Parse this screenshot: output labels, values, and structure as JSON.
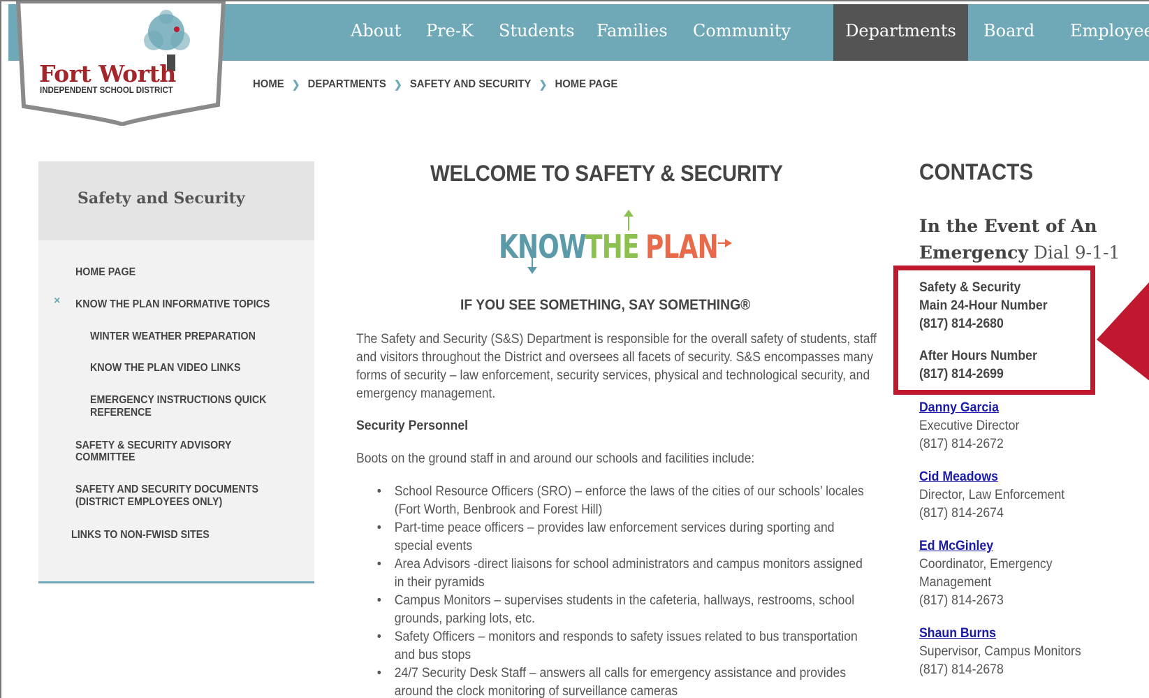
{
  "nav": {
    "items": [
      "About",
      "Pre-K",
      "Students",
      "Families",
      "Community",
      "Departments",
      "Board",
      "Employees"
    ],
    "active": "Departments"
  },
  "logo": {
    "title": "Fort Worth",
    "subtitle": "INDEPENDENT SCHOOL DISTRICT"
  },
  "breadcrumb": [
    "HOME",
    "DEPARTMENTS",
    "SAFETY AND SECURITY",
    "HOME PAGE"
  ],
  "sidebar": {
    "title": "Safety and Security",
    "collapse_symbol": "×",
    "items": [
      "HOME PAGE",
      "KNOW THE PLAN INFORMATIVE TOPICS",
      "WINTER WEATHER PREPARATION",
      "KNOW THE PLAN VIDEO LINKS",
      "EMERGENCY INSTRUCTIONS QUICK",
      "REFERENCE",
      "SAFETY & SECURITY ADVISORY",
      "COMMITTEE",
      "SAFETY AND SECURITY DOCUMENTS",
      "(DISTRICT EMPLOYEES ONLY)",
      "LINKS TO NON-FWISD SITES"
    ]
  },
  "main": {
    "title": "WELCOME TO SAFETY & SECURITY",
    "banner": {
      "know": "KNOW",
      "the": "THE",
      "plan": "PLAN"
    },
    "tagline": "IF YOU SEE SOMETHING, SAY SOMETHING®",
    "intro": "The Safety and Security (S&S) Department is responsible for the overall safety of students, staff and visitors throughout the District and oversees all facets of security.  S&S encompasses many forms of security – law enforcement, security services, physical and technological security, and emergency management.",
    "personnel_heading": "Security Personnel",
    "personnel_intro": "Boots on the ground staff in and around our schools and facilities include:",
    "bullets": [
      "School Resource Officers (SRO) – enforce the laws of the cities of our schools’ locales (Fort Worth, Benbrook and Forest Hill)",
      "Part-time peace officers – provides law enforcement services during sporting and special events",
      "Area Advisors -direct liaisons for school administrators and campus monitors assigned in their pyramids",
      "Campus Monitors – supervises students in the cafeteria, hallways, restrooms, school grounds, parking lots, etc.",
      "Safety Officers – monitors and responds to safety issues related to bus transportation and bus stops",
      "24/7 Security Desk Staff – answers all calls for emergency assistance and provides around the clock monitoring of surveillance cameras"
    ]
  },
  "contacts": {
    "heading": "CONTACTS",
    "emergency_bold": "In the Event of An Emergency",
    "emergency_dial": " Dial 9-1-1",
    "main_line_1": "Safety & Security",
    "main_line_2": "Main 24-Hour Number",
    "main_phone": "(817) 814-2680",
    "after_label": "After Hours Number",
    "after_phone": "(817) 814-2699",
    "people": [
      {
        "name": "Danny Garcia ",
        "title": "Executive Director",
        "phone": "(817) 814-2672"
      },
      {
        "name": "Cid Meadows",
        "title": "Director, Law Enforcement",
        "phone": "(817) 814-2674"
      },
      {
        "name": "Ed McGinley",
        "title": "Coordinator, Emergency",
        "title2": "Management",
        "phone": "(817) 814-2673"
      },
      {
        "name": "Shaun Burns",
        "title": "Supervisor, Campus Monitors",
        "phone": "(817) 814-2678"
      }
    ]
  },
  "colors": {
    "nav_bg": "#6fa9b8",
    "nav_active": "#545454",
    "highlight": "#c0182e",
    "brand_red": "#a3262b",
    "link": "#1a1aa8"
  }
}
